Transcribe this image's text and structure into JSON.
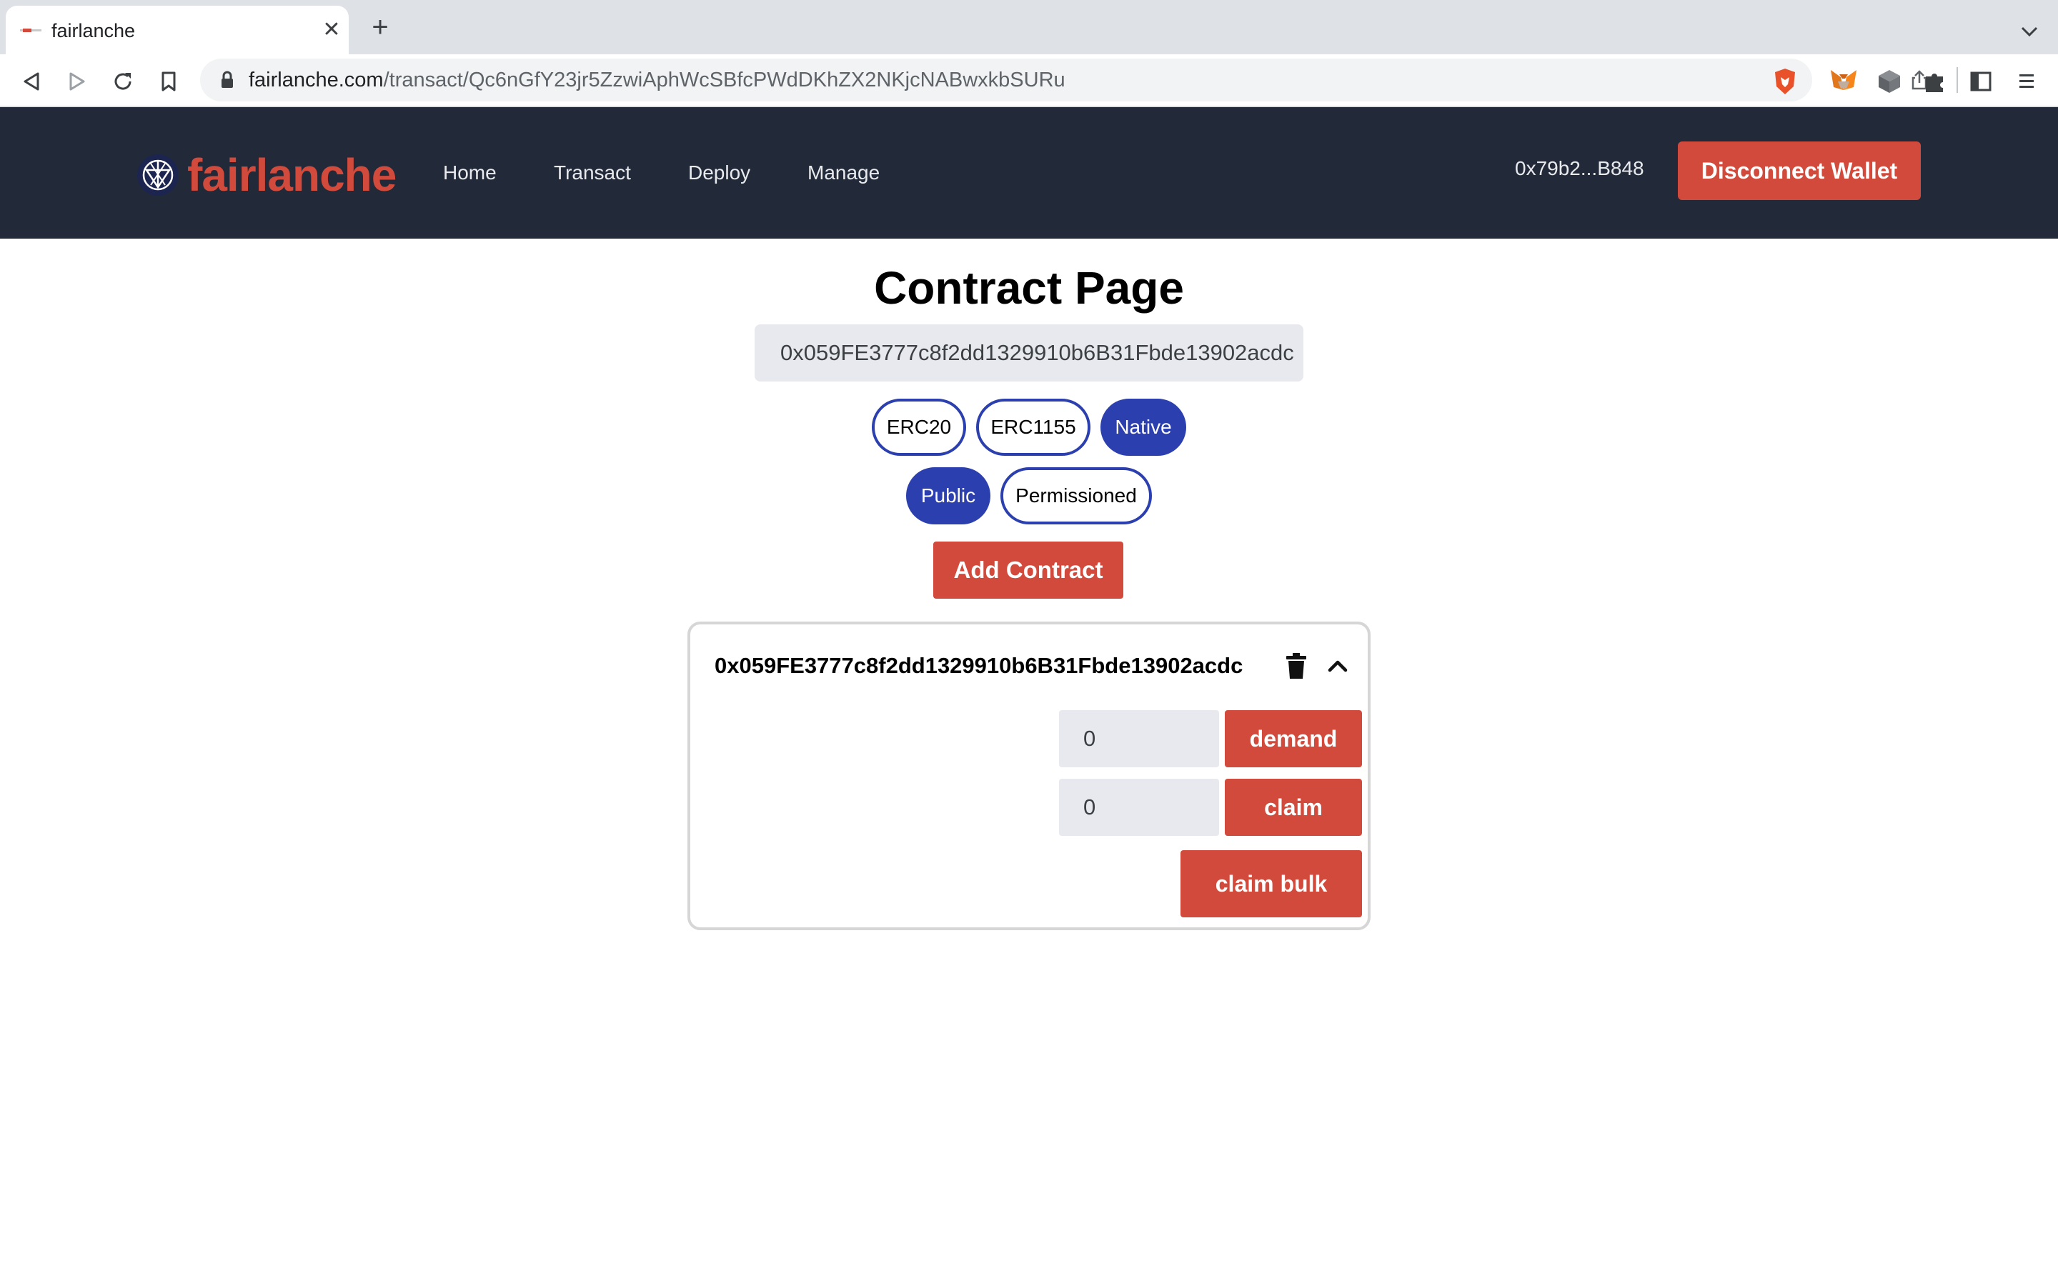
{
  "browser": {
    "tab_title": "fairlanche",
    "url_domain": "fairlanche.com",
    "url_path": "/transact/Qc6nGfY23jr5ZzwiAphWcSBfcPWdDKhZX2NKjcNABwxkbSURu"
  },
  "header": {
    "logo_text": "fairlanche",
    "nav": [
      "Home",
      "Transact",
      "Deploy",
      "Manage"
    ],
    "wallet_address": "0x79b2...B848",
    "disconnect_label": "Disconnect Wallet",
    "brand_color": "#d24a3b",
    "bg_color": "#222938"
  },
  "main": {
    "title": "Contract Page",
    "contract_input_value": "0x059FE3777c8f2dd1329910b6B31Fbde13902acdc",
    "token_types": [
      {
        "label": "ERC20",
        "selected": false
      },
      {
        "label": "ERC1155",
        "selected": false
      },
      {
        "label": "Native",
        "selected": true
      }
    ],
    "access_types": [
      {
        "label": "Public",
        "selected": true
      },
      {
        "label": "Permissioned",
        "selected": false
      }
    ],
    "add_contract_label": "Add Contract",
    "accent_color": "#2b3fae"
  },
  "contract_card": {
    "address": "0x059FE3777c8f2dd1329910b6B31Fbde13902acdc",
    "demand_value": "0",
    "demand_label": "demand",
    "claim_value": "0",
    "claim_label": "claim",
    "claim_bulk_label": "claim bulk"
  }
}
